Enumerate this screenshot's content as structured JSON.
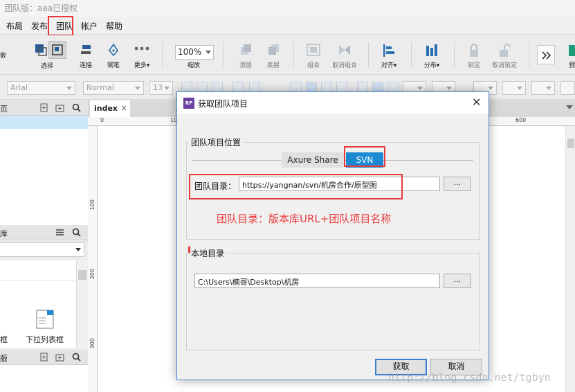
{
  "app": {
    "title": "团队版：aaa已授权"
  },
  "menu": [
    "布局",
    "发布",
    "团队",
    "帐户",
    "帮助"
  ],
  "toolbar": {
    "left_fragment": "散",
    "select": "选择",
    "connect": "连接",
    "pen": "钢笔",
    "more": "更多▾",
    "zoom": "100%",
    "zoom_label": "缩放",
    "top": "顶层",
    "bottom": "底层",
    "group": "组合",
    "ungroup": "取消组合",
    "align": "对齐▾",
    "distribute": "分布▾",
    "lock": "锁定",
    "unlock": "取消锁定",
    "right_fragment": "预"
  },
  "format": {
    "font": "Arial",
    "style": "Normal",
    "size": "13"
  },
  "left": {
    "pages_title_fragment": "页",
    "library_title_fragment": "库",
    "widget_left_label": "框",
    "widget_droplist_label": "下拉列表框",
    "bottom_title_fragment": "版"
  },
  "canvas": {
    "tab": "index",
    "tab_close": "×",
    "ruler_top": [
      "0",
      "10",
      "600"
    ],
    "ruler_left": [
      "100",
      "200",
      "300"
    ]
  },
  "dialog": {
    "logo": "RP",
    "title": "获取团队项目",
    "close": "✕",
    "group_location": "团队项目位置",
    "tab_axure": "Axure Share",
    "tab_svn": "SVN",
    "team_dir_label": "团队目录：",
    "team_dir_value": "https://yangnan/svn/机房合作/原型图",
    "browse": "...",
    "annotation": "团队目录：版本库URL+团队项目名称",
    "group_local": "本地目录",
    "local_dir_value": "C:\\Users\\楠哥\\Desktop\\机房",
    "ok": "获取",
    "cancel": "取消"
  },
  "watermark": "http://blog.csdn.net/tgbyn",
  "colors": {
    "accent": "#1b8ad3",
    "highlight": "#e8393a",
    "dialog_border": "#4b8ad6"
  }
}
